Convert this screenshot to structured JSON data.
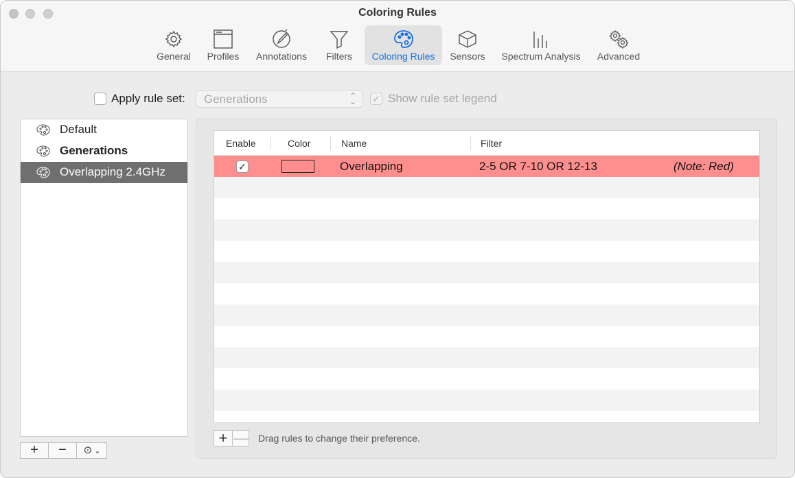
{
  "window": {
    "title": "Coloring Rules"
  },
  "toolbar": {
    "items": [
      {
        "label": "General",
        "icon": "gear-icon"
      },
      {
        "label": "Profiles",
        "icon": "window-icon"
      },
      {
        "label": "Annotations",
        "icon": "pen-circle-icon"
      },
      {
        "label": "Filters",
        "icon": "funnel-icon"
      },
      {
        "label": "Coloring Rules",
        "icon": "palette-icon",
        "active": true
      },
      {
        "label": "Sensors",
        "icon": "cube-icon"
      },
      {
        "label": "Spectrum Analysis",
        "icon": "bars-icon"
      },
      {
        "label": "Advanced",
        "icon": "gears-icon"
      }
    ],
    "active_color": "#1470e4"
  },
  "apply": {
    "label": "Apply rule set:",
    "checked": false,
    "select_value": "Generations",
    "legend_label": "Show rule set legend",
    "legend_checked": true
  },
  "rule_sets": {
    "items": [
      {
        "label": "Default",
        "icon": "palette-icon"
      },
      {
        "label": "Generations",
        "icon": "palette-icon",
        "bold": true
      },
      {
        "label": "Overlapping 2.4GHz",
        "icon": "palette-icon",
        "selected": true
      }
    ],
    "buttons": {
      "add": "+",
      "remove": "−",
      "more": "⊙"
    }
  },
  "rules_table": {
    "columns": [
      "Enable",
      "Color",
      "Name",
      "Filter"
    ],
    "rows": [
      {
        "enabled": true,
        "color": "#ff8f8f",
        "name": "Overlapping",
        "filter": "2-5 OR 7-10 OR 12-13",
        "note": "(Note: Red)"
      }
    ],
    "hint": "Drag rules to change their preference.",
    "buttons": {
      "add": "+",
      "remove": "—"
    }
  }
}
